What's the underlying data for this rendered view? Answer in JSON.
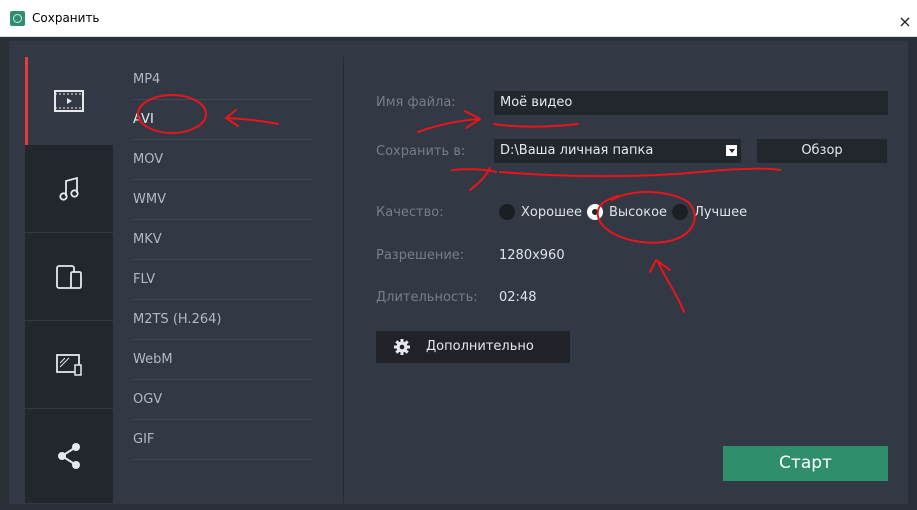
{
  "window": {
    "title": "Сохранить",
    "close_label": "×"
  },
  "rail": {
    "tabs": [
      {
        "name": "video",
        "icon": "film-icon",
        "active": true
      },
      {
        "name": "audio",
        "icon": "music-note-icon",
        "active": false
      },
      {
        "name": "devices",
        "icon": "devices-icon",
        "active": false
      },
      {
        "name": "tv",
        "icon": "tv-icon",
        "active": false
      },
      {
        "name": "share",
        "icon": "share-icon",
        "active": false
      }
    ]
  },
  "formats": {
    "items": [
      "MP4",
      "AVI",
      "MOV",
      "WMV",
      "MKV",
      "FLV",
      "M2TS (H.264)",
      "WebM",
      "OGV",
      "GIF"
    ],
    "selected": "AVI"
  },
  "settings": {
    "filename_label": "Имя файла:",
    "filename_value": "Моё видео",
    "save_to_label": "Сохранить в:",
    "save_to_value": "D:\\Ваша личная папка",
    "browse_label": "Обзор",
    "quality_label": "Качество:",
    "quality_options": [
      "Хорошее",
      "Высокое",
      "Лучшее"
    ],
    "quality_selected": "Высокое",
    "resolution_label": "Разрешение:",
    "resolution_value": "1280x960",
    "duration_label": "Длительность:",
    "duration_value": "02:48",
    "advanced_label": "Дополнительно",
    "start_label": "Старт"
  },
  "colors": {
    "accent": "#e53b3b",
    "start_button": "#2f8f6d",
    "annotation": "#e8151b",
    "panel": "#323844",
    "rail": "#22262d"
  }
}
